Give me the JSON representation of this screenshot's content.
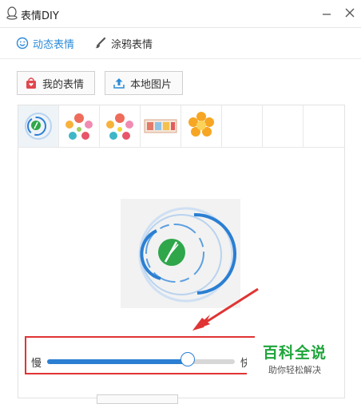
{
  "window": {
    "title": "表情DIY"
  },
  "tabs": [
    {
      "label": "动态表情",
      "active": true,
      "icon": "smile-icon"
    },
    {
      "label": "涂鸦表情",
      "active": false,
      "icon": "brush-icon"
    }
  ],
  "toolbar": {
    "my_emoji_label": "我的表情",
    "local_image_label": "本地图片"
  },
  "thumbnails": [
    {
      "name": "feather-ring",
      "selected": true
    },
    {
      "name": "colorful-dots-1",
      "selected": false
    },
    {
      "name": "colorful-dots-2",
      "selected": false
    },
    {
      "name": "film-strip",
      "selected": false
    },
    {
      "name": "orange-flower",
      "selected": false
    },
    {
      "name": "empty",
      "selected": false
    },
    {
      "name": "empty",
      "selected": false
    },
    {
      "name": "empty",
      "selected": false
    }
  ],
  "speed": {
    "slow_label": "慢",
    "fast_label": "快",
    "value": 0.75
  },
  "watermark": {
    "title": "百科全说",
    "subtitle": "助你轻松解决"
  },
  "colors": {
    "accent": "#2b7fd2",
    "annotation": "#e03434",
    "brand_green": "#1ea53b"
  }
}
